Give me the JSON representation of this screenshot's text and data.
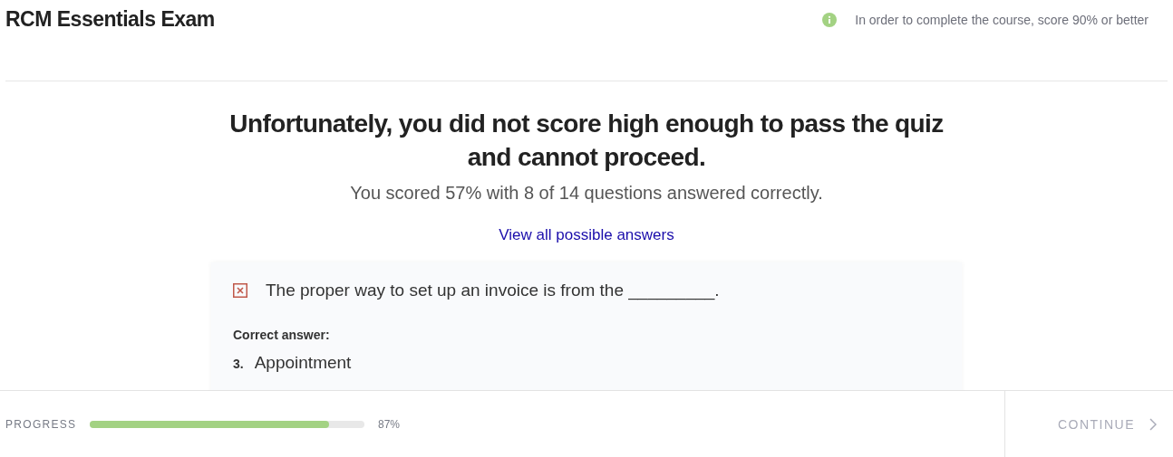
{
  "header": {
    "title": "RCM Essentials Exam",
    "notice": "In order to complete the course, score 90% or better"
  },
  "result": {
    "heading": "Unfortunately, you did not score high enough to pass the quiz and cannot proceed.",
    "summary": "You scored 57% with 8 of 14 questions answered correctly.",
    "link": "View all possible answers"
  },
  "questions": [
    {
      "correct": false,
      "text": "The proper way to set up an invoice is from the _________.",
      "answer_label": "Correct answer:",
      "answer_number": "3.",
      "answer": "Appointment"
    }
  ],
  "footer": {
    "progress_label": "PROGRESS",
    "level": 0.87,
    "reading": "87%",
    "continue": {
      "label": "CONTINUE",
      "disabled": true
    }
  }
}
